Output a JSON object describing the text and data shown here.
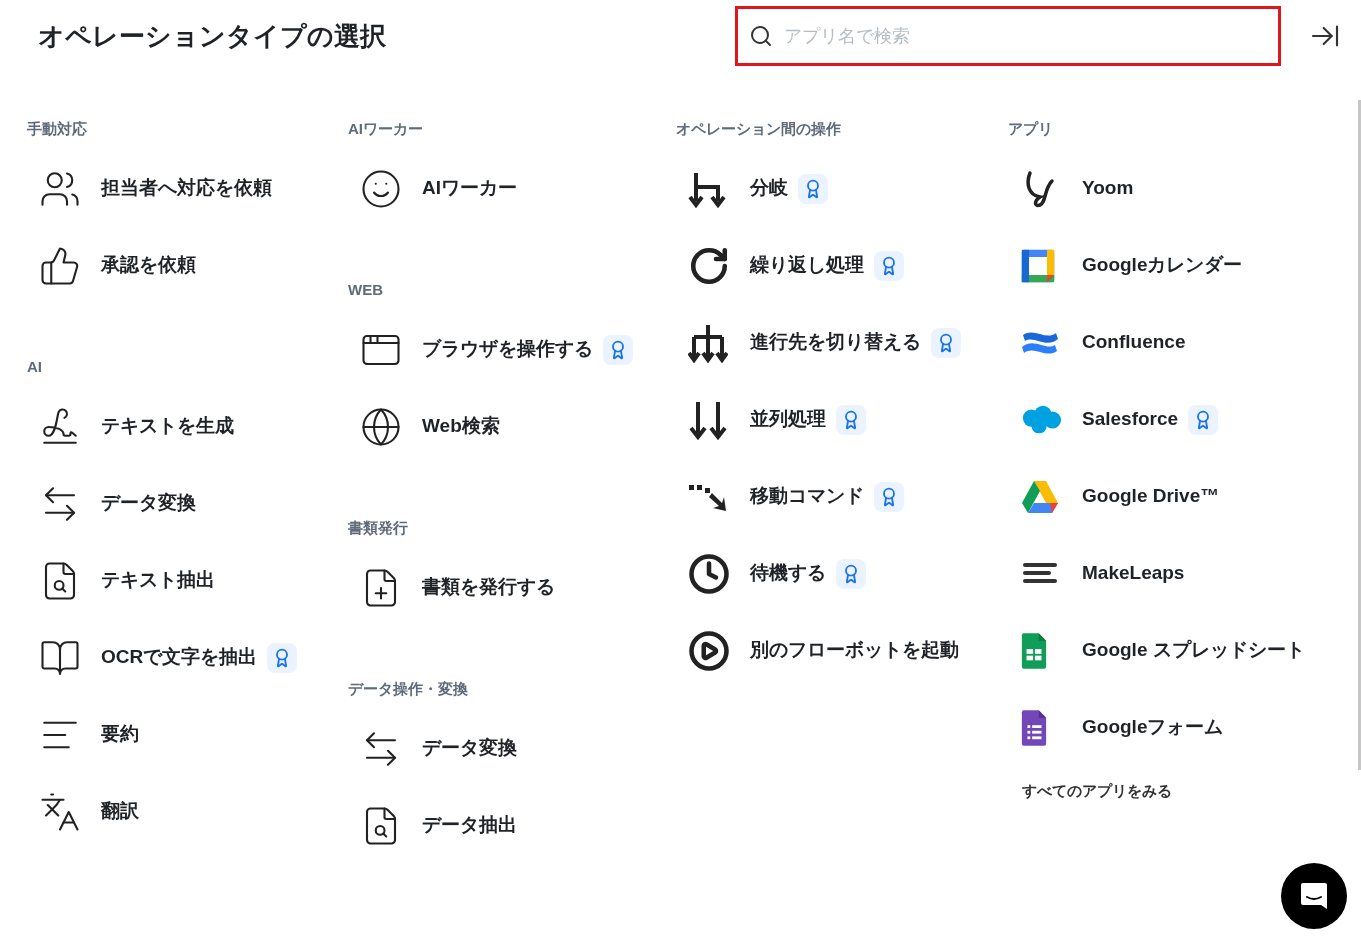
{
  "title": "オペレーションタイプの選択",
  "search": {
    "placeholder": "アプリ名で検索",
    "highlighted": true
  },
  "columns": [
    {
      "sections": [
        {
          "heading": "手動対応",
          "items": [
            {
              "label": "担当者へ対応を依頼",
              "premium": false
            },
            {
              "label": "承認を依頼",
              "premium": false
            }
          ]
        },
        {
          "heading": "AI",
          "items": [
            {
              "label": "テキストを生成",
              "premium": false
            },
            {
              "label": "データ変換",
              "premium": false
            },
            {
              "label": "テキスト抽出",
              "premium": false
            },
            {
              "label": "OCRで文字を抽出",
              "premium": true
            },
            {
              "label": "要約",
              "premium": false
            },
            {
              "label": "翻訳",
              "premium": false
            }
          ]
        }
      ]
    },
    {
      "sections": [
        {
          "heading": "AIワーカー",
          "items": [
            {
              "label": "AIワーカー",
              "premium": false
            }
          ]
        },
        {
          "heading": "WEB",
          "items": [
            {
              "label": "ブラウザを操作する",
              "premium": true
            },
            {
              "label": "Web検索",
              "premium": false
            }
          ]
        },
        {
          "heading": "書類発行",
          "items": [
            {
              "label": "書類を発行する",
              "premium": false
            }
          ]
        },
        {
          "heading": "データ操作・変換",
          "items": [
            {
              "label": "データ変換",
              "premium": false
            },
            {
              "label": "データ抽出",
              "premium": false
            }
          ]
        }
      ]
    },
    {
      "sections": [
        {
          "heading": "オペレーション間の操作",
          "items": [
            {
              "label": "分岐",
              "premium": true
            },
            {
              "label": "繰り返し処理",
              "premium": true
            },
            {
              "label": "進行先を切り替える",
              "premium": true
            },
            {
              "label": "並列処理",
              "premium": true
            },
            {
              "label": "移動コマンド",
              "premium": true
            },
            {
              "label": "待機する",
              "premium": true
            },
            {
              "label": "別のフローボットを起動",
              "premium": false
            }
          ]
        }
      ]
    },
    {
      "sections": [
        {
          "heading": "アプリ",
          "items": [
            {
              "label": "Yoom",
              "premium": false
            },
            {
              "label": "Googleカレンダー",
              "premium": false
            },
            {
              "label": "Confluence",
              "premium": false
            },
            {
              "label": "Salesforce",
              "premium": true
            },
            {
              "label": "Google Drive™",
              "premium": false
            },
            {
              "label": "MakeLeaps",
              "premium": false
            },
            {
              "label": "Google スプレッドシート",
              "premium": false
            },
            {
              "label": "Googleフォーム",
              "premium": false
            }
          ]
        }
      ],
      "link": "すべてのアプリをみる"
    }
  ]
}
